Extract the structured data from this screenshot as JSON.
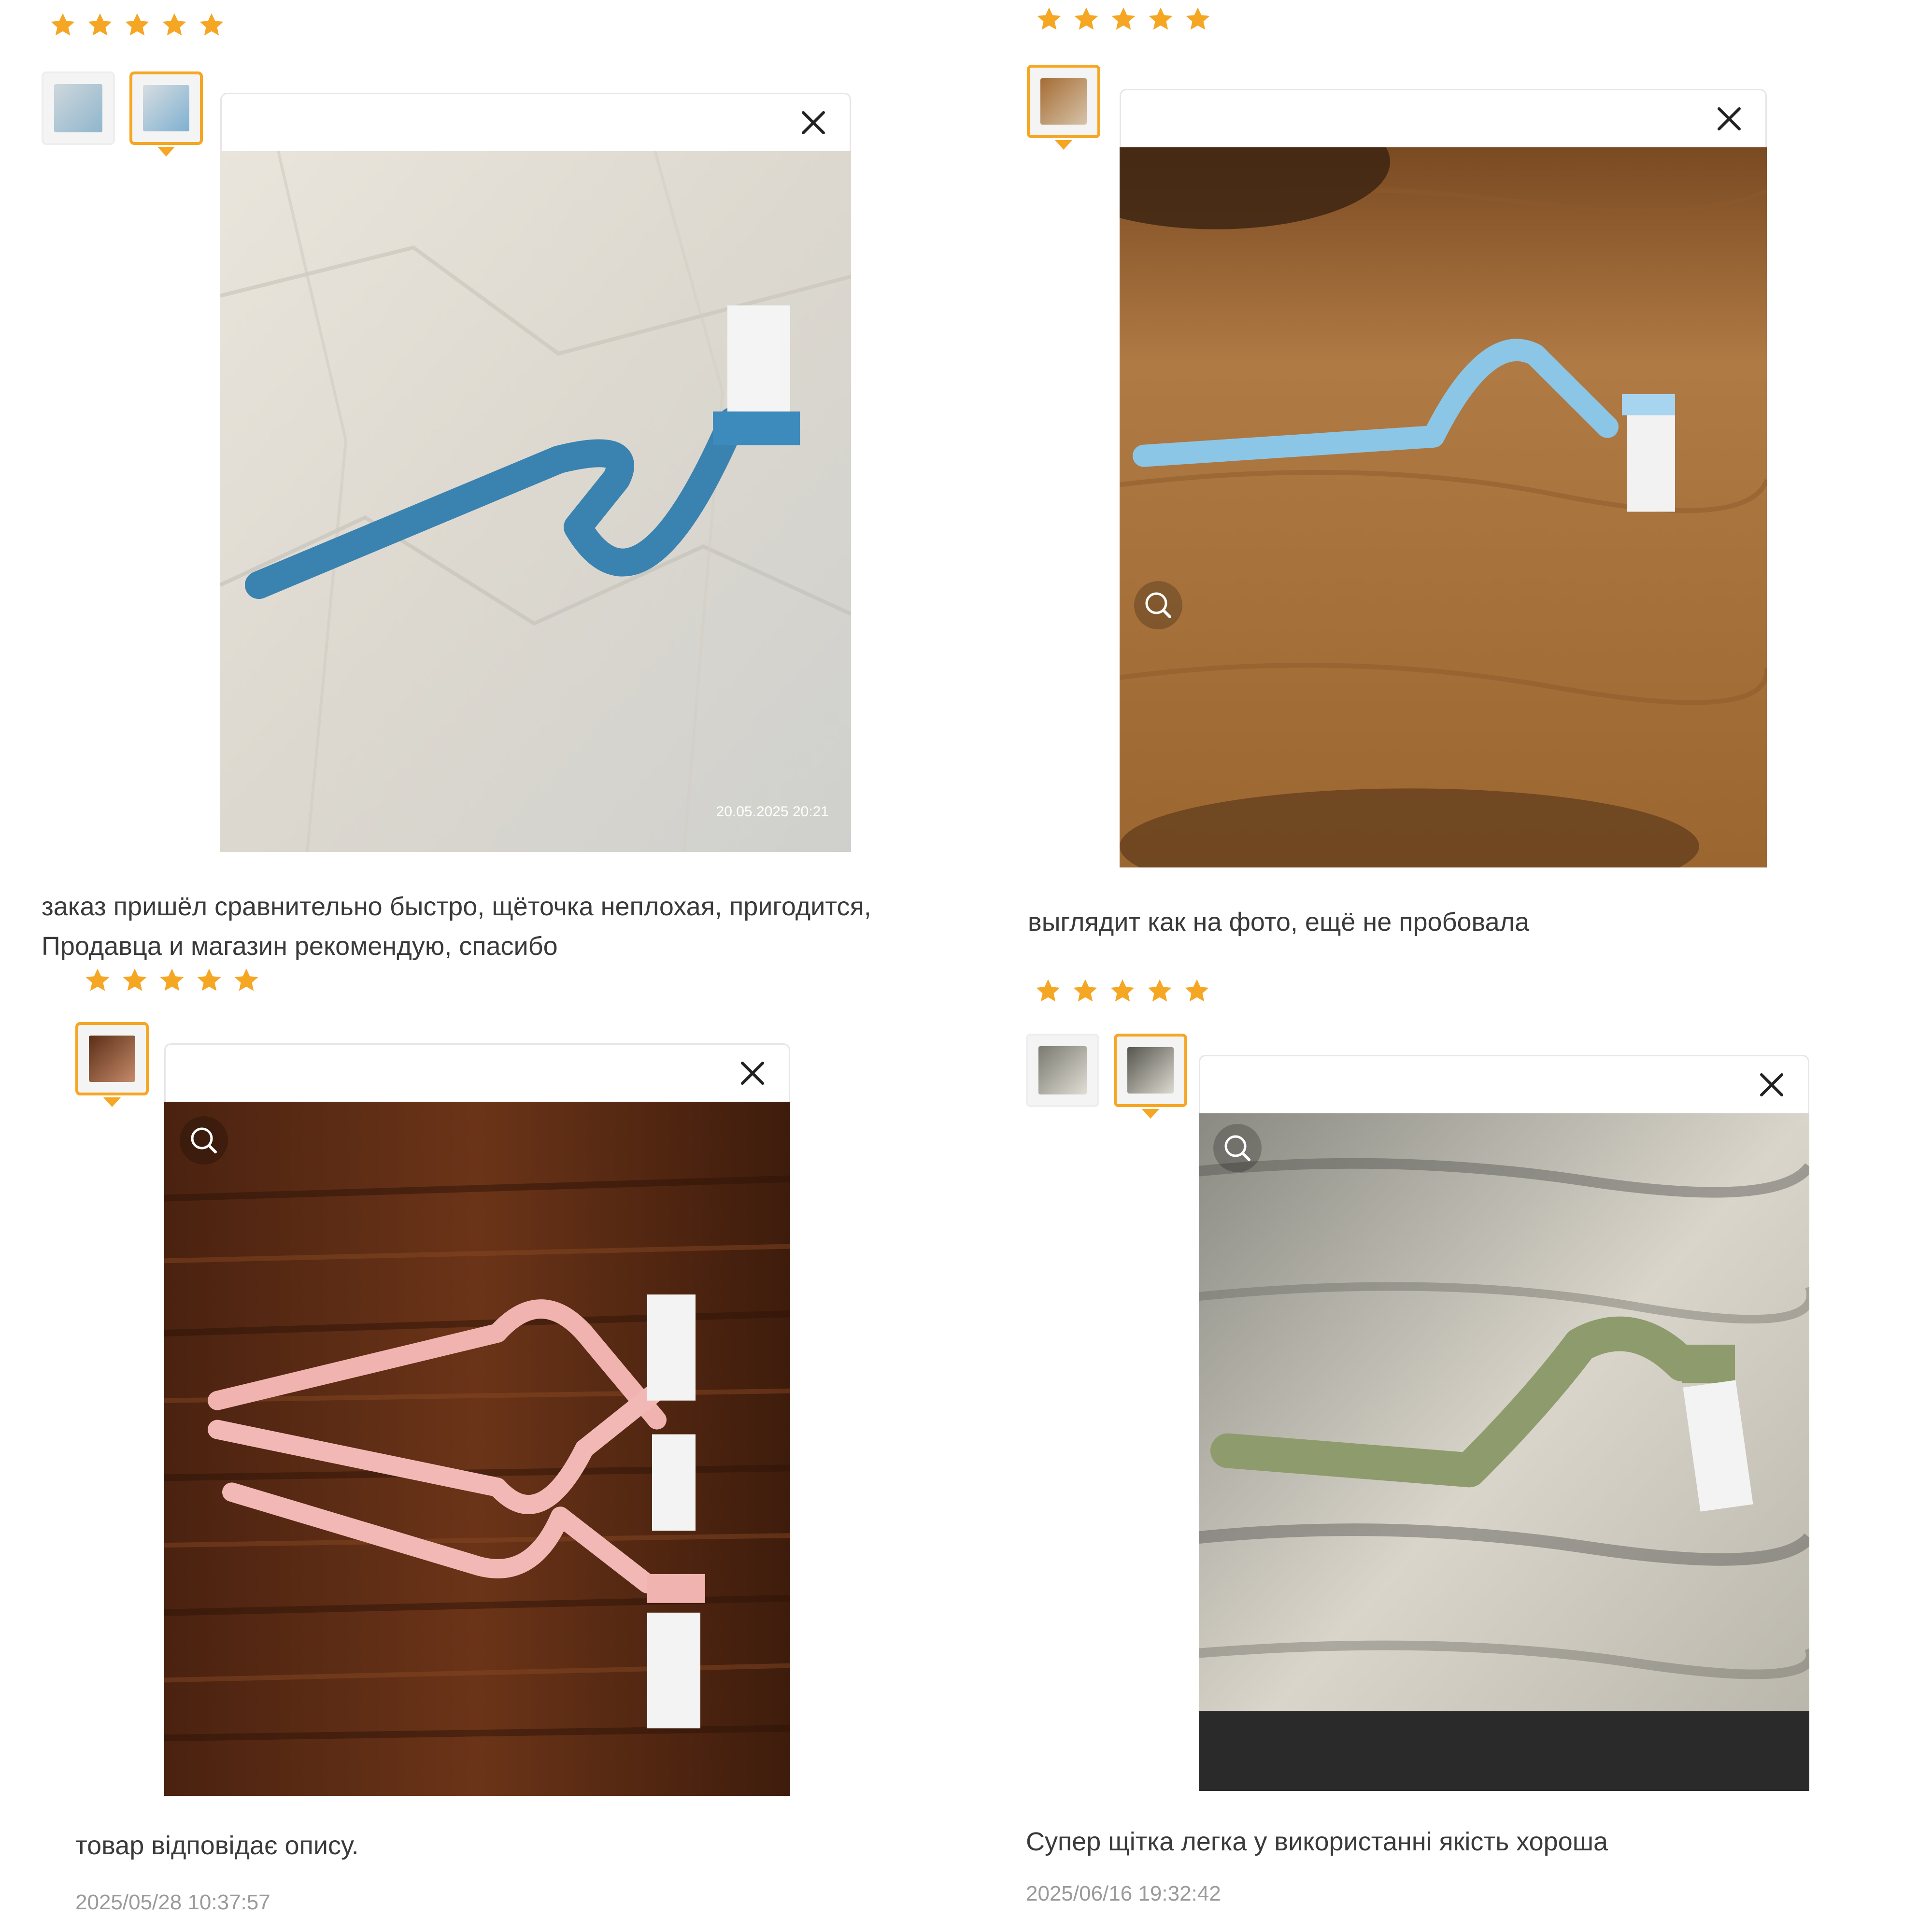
{
  "star_color": "#f5a623",
  "reviews": [
    {
      "stars": 5,
      "thumbnails": [
        {
          "active": false
        },
        {
          "active": true
        }
      ],
      "photo": {
        "subject": "blue-toilet-brush",
        "background": "crumpled-white-sheet",
        "watermark": "20.05.2025 20:21"
      },
      "text": "заказ пришёл сравнительно быстро, щёточка неплохая, пригодится,\nПродавца и магазин рекомендую, спасибо",
      "date": ""
    },
    {
      "stars": 5,
      "thumbnails": [
        {
          "active": true
        }
      ],
      "photo": {
        "subject": "light-blue-toilet-brush",
        "background": "wood-table"
      },
      "text": "выглядит как на фото, ещё не пробовала",
      "date": ""
    },
    {
      "stars": 5,
      "thumbnails": [
        {
          "active": true
        }
      ],
      "photo": {
        "subject": "two-pink-toilet-brushes",
        "background": "dark-wood"
      },
      "text": "товар відповідає опису.",
      "date": "2025/05/28 10:37:57"
    },
    {
      "stars": 5,
      "thumbnails": [
        {
          "active": false
        },
        {
          "active": true
        }
      ],
      "photo": {
        "subject": "green-toilet-brush",
        "background": "weathered-wood"
      },
      "text": "Супер щітка легка у використанні якість хороша",
      "date": "2025/06/16 19:32:42"
    }
  ]
}
